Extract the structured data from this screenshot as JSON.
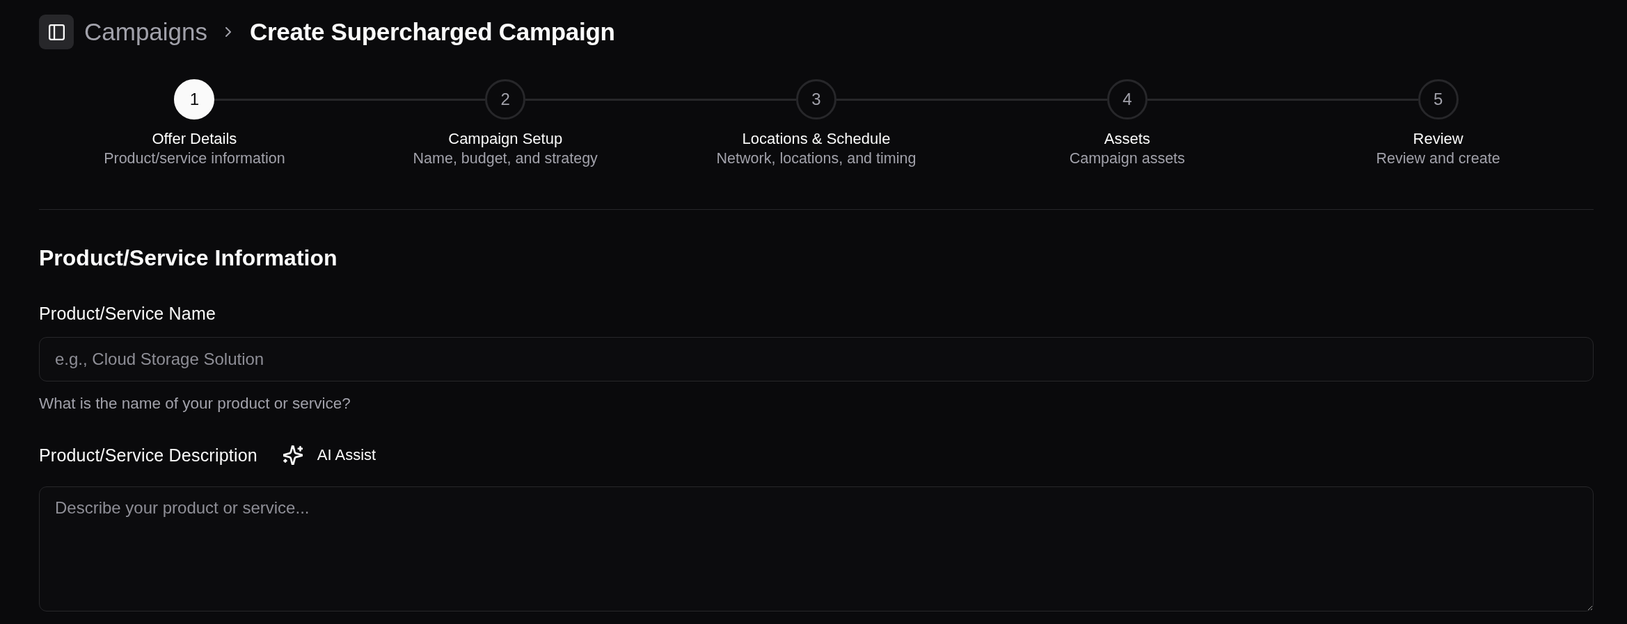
{
  "header": {
    "breadcrumb": "Campaigns",
    "title": "Create Supercharged Campaign"
  },
  "steps": [
    {
      "number": "1",
      "title": "Offer Details",
      "subtitle": "Product/service information",
      "selected": true
    },
    {
      "number": "2",
      "title": "Campaign Setup",
      "subtitle": "Name, budget, and strategy",
      "selected": false
    },
    {
      "number": "3",
      "title": "Locations & Schedule",
      "subtitle": "Network, locations, and timing",
      "selected": false
    },
    {
      "number": "4",
      "title": "Assets",
      "subtitle": "Campaign assets",
      "selected": false
    },
    {
      "number": "5",
      "title": "Review",
      "subtitle": "Review and create",
      "selected": false
    }
  ],
  "section": {
    "heading": "Product/Service Information",
    "fields": [
      {
        "kind": "input",
        "label": "Product/Service Name",
        "placeholder": "e.g., Cloud Storage Solution",
        "help": "What is the name of your product or service?"
      },
      {
        "kind": "textarea",
        "label": "Product/Service Description",
        "assist": "AI Assist",
        "placeholder": "Describe your product or service..."
      }
    ]
  }
}
